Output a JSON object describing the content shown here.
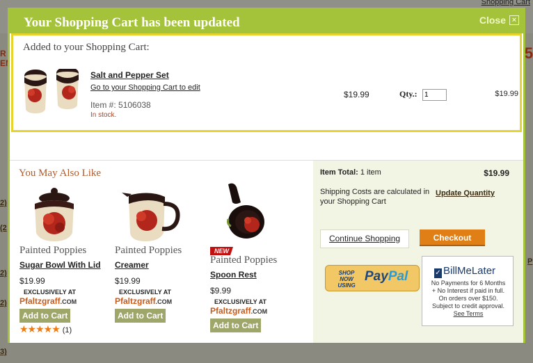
{
  "background_page": {
    "top_right_link": "Shopping Cart",
    "left_fragments": [
      "2)",
      "(2",
      "2)",
      "2)",
      "3)"
    ],
    "left_red_fragments": [
      "R",
      "EM"
    ],
    "right_fragments": [
      "5",
      "P"
    ]
  },
  "modal": {
    "title": "Your Shopping Cart has been updated",
    "close_label": "Close",
    "close_icon": "close-x-icon",
    "added": {
      "heading": "Added to your Shopping Cart:",
      "product_name": "Salt and Pepper Set",
      "edit_link": "Go to your Shopping Cart to edit",
      "item_number": "Item #:  5106038",
      "stock_status": "In stock.",
      "unit_price": "$19.99",
      "qty_label": "Qty.:",
      "qty_value": "1",
      "line_total": "$19.99"
    },
    "recommendations": {
      "heading": "You May Also Like",
      "items": [
        {
          "brand": "Painted Poppies",
          "name": "Sugar Bowl With Lid",
          "price": "$19.99",
          "exclusive": "EXCLUSIVELY AT",
          "retailer": "Pfaltzgraff",
          "retailer_suffix": ".COM",
          "add_to_cart": "Add to Cart",
          "rating_count": "(1)",
          "stars": 5
        },
        {
          "brand": "Painted Poppies",
          "name": "Creamer",
          "price": "$19.99",
          "exclusive": "EXCLUSIVELY AT",
          "retailer": "Pfaltzgraff",
          "retailer_suffix": ".COM",
          "add_to_cart": "Add to Cart"
        },
        {
          "badge": "NEW",
          "brand": "Painted Poppies",
          "name": "Spoon Rest",
          "price": "$9.99",
          "exclusive": "EXCLUSIVELY AT",
          "retailer": "Pfaltzgraff",
          "retailer_suffix": ".COM",
          "add_to_cart": "Add to Cart"
        }
      ]
    },
    "summary": {
      "item_total_label": "Item Total:",
      "item_total_count": " 1 item",
      "item_total_value": "$19.99",
      "shipping_note": "Shipping Costs are calculated in your Shopping Cart",
      "update_quantity": "Update Quantity",
      "continue_shopping": "Continue Shopping",
      "checkout": "Checkout",
      "paypal_small": "SHOP NOW USING",
      "paypal_pay": "Pay",
      "paypal_pal": "Pal",
      "bml_logo": "BillMeLater",
      "bml_line1": "No Payments for 6 Months",
      "bml_line2": "+ No Interest if paid in full.",
      "bml_line3": "On orders over $150.",
      "bml_line4": "Subject to credit approval.",
      "bml_terms": "See Terms"
    }
  },
  "colors": {
    "header_green": "#a4c23a",
    "added_border": "#e6d32c",
    "checkout_orange": "#e07f15",
    "add_to_cart": "#9fa66a",
    "summary_bg": "#f2f5e3",
    "heading_brown": "#b05a2a"
  }
}
